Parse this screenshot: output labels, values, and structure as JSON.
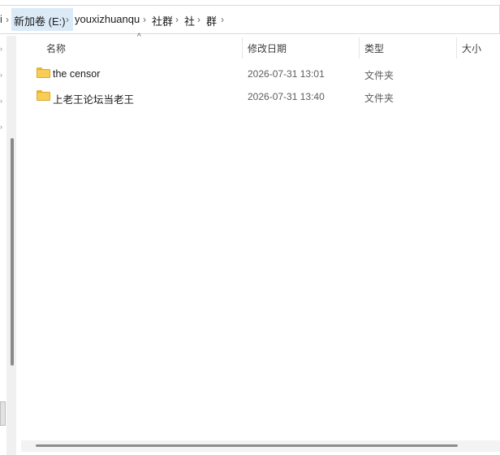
{
  "address_bar": {
    "cut_prev": "i",
    "crumbs": [
      "新加卷 (E:)",
      "youxizhuanqu",
      "社群",
      "社",
      "群"
    ],
    "separator": "›"
  },
  "header": {
    "sort_indicator": "^",
    "columns": [
      "名称",
      "修改日期",
      "类型",
      "大小"
    ]
  },
  "files": [
    {
      "name": "the censor",
      "modified": "2026-07-31 13:01",
      "type": "文件夹",
      "icon": "folder-icon"
    },
    {
      "name": "上老王论坛当老王",
      "modified": "2026-07-31 13:40",
      "type": "文件夹",
      "icon": "folder-icon"
    }
  ],
  "colors": {
    "folder": "#f7cd55",
    "active_crumb": "#dbeaf7"
  }
}
